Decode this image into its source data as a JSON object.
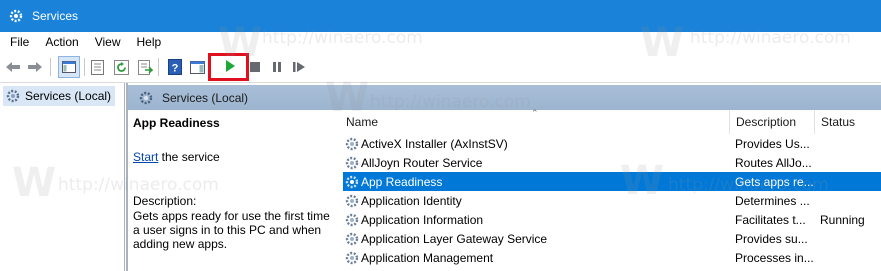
{
  "window": {
    "title": "Services"
  },
  "menu": [
    "File",
    "Action",
    "View",
    "Help"
  ],
  "tree": {
    "root_label": "Services (Local)"
  },
  "header": {
    "title": "Services (Local)"
  },
  "description_panel": {
    "service_name": "App Readiness",
    "start_link": "Start",
    "start_suffix": " the service",
    "description_label": "Description:",
    "description_text": "Gets apps ready for use the first time a user signs in to this PC and when adding new apps."
  },
  "columns": {
    "name": "Name",
    "description": "Description",
    "status": "Status"
  },
  "services": [
    {
      "name": "ActiveX Installer (AxInstSV)",
      "description": "Provides Us...",
      "status": ""
    },
    {
      "name": "AllJoyn Router Service",
      "description": "Routes AllJo...",
      "status": ""
    },
    {
      "name": "App Readiness",
      "description": "Gets apps re...",
      "status": ""
    },
    {
      "name": "Application Identity",
      "description": "Determines ...",
      "status": ""
    },
    {
      "name": "Application Information",
      "description": "Facilitates t...",
      "status": "Running"
    },
    {
      "name": "Application Layer Gateway Service",
      "description": "Provides su...",
      "status": ""
    },
    {
      "name": "Application Management",
      "description": "Processes in...",
      "status": ""
    }
  ],
  "watermark": {
    "text": "http://winaero.com",
    "letter": "W"
  },
  "colors": {
    "titlebar": "#1a82d8",
    "selection": "#0078d7",
    "highlight_box": "#e0101e",
    "play_green": "#1fa83a"
  }
}
